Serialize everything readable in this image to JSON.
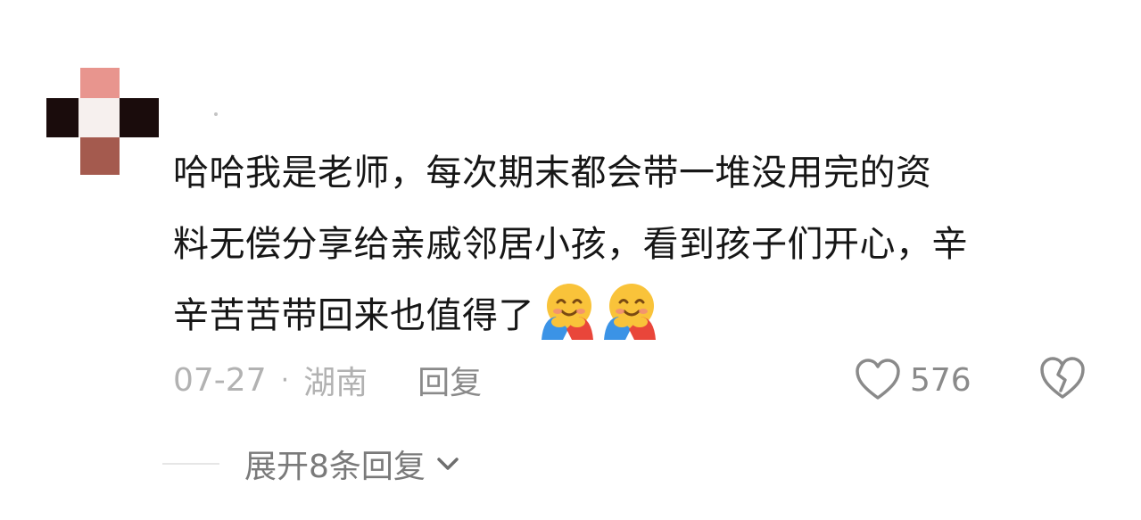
{
  "comment": {
    "username": "",
    "content_lines": [
      "哈哈我是老师，每次期末都会带一堆没用完的资",
      "料无偿分享给亲戚邻居小孩，看到孩子们开心，辛",
      "辛苦苦带回来也值得了"
    ],
    "emojis": [
      "hugging-face-emoji",
      "hugging-face-emoji"
    ],
    "date": "07-27",
    "separator": "·",
    "location": "湖南",
    "reply_label": "回复",
    "like_count": "576",
    "expand_replies_label": "展开8条回复"
  },
  "icons": {
    "like": "heart-outline-icon",
    "dislike": "broken-heart-icon",
    "expand": "chevron-down-icon"
  },
  "colors": {
    "text_primary": "#161616",
    "text_muted": "#b2b2b2",
    "icon_gray": "#8a8a8a",
    "avatar_pink": "#e8958e",
    "avatar_dark": "#1a0c0c",
    "avatar_brown": "#a45a4e"
  }
}
